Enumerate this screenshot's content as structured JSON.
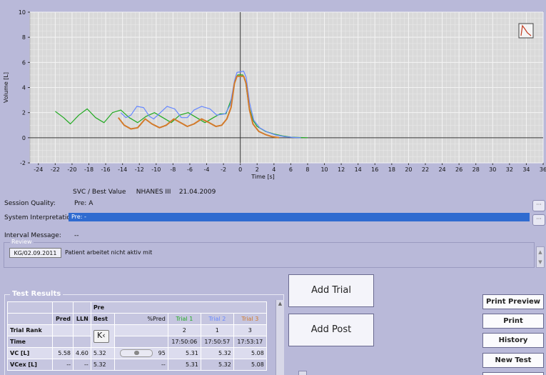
{
  "chart_data": {
    "type": "line",
    "xlabel": "Time [s]",
    "ylabel": "Volume [L]",
    "xlim": [
      -25,
      36
    ],
    "ylim": [
      -2,
      10
    ],
    "xticks": [
      -24,
      -22,
      -20,
      -18,
      -16,
      -14,
      -12,
      -10,
      -8,
      -6,
      -4,
      -2,
      0,
      2,
      4,
      6,
      8,
      10,
      12,
      14,
      16,
      18,
      20,
      22,
      24,
      26,
      28,
      30,
      32,
      34,
      36
    ],
    "yticks": [
      -2,
      0,
      2,
      4,
      6,
      8,
      10
    ],
    "grid": true,
    "series": [
      {
        "name": "Trial 1",
        "color": "#22aa22",
        "points": [
          [
            -22,
            2.1
          ],
          [
            -21,
            1.6
          ],
          [
            -20.2,
            1.1
          ],
          [
            -19.2,
            1.8
          ],
          [
            -18.2,
            2.3
          ],
          [
            -17.2,
            1.6
          ],
          [
            -16.2,
            1.2
          ],
          [
            -15.2,
            2.0
          ],
          [
            -14.2,
            2.2
          ],
          [
            -13.2,
            1.6
          ],
          [
            -12.2,
            1.2
          ],
          [
            -11.2,
            1.7
          ],
          [
            -10.2,
            2.0
          ],
          [
            -9.2,
            1.6
          ],
          [
            -8.2,
            1.2
          ],
          [
            -7.2,
            1.8
          ],
          [
            -6.2,
            2.0
          ],
          [
            -5.2,
            1.6
          ],
          [
            -4.2,
            1.2
          ],
          [
            -3.2,
            1.6
          ],
          [
            -2.4,
            1.9
          ],
          [
            -1.7,
            1.9
          ],
          [
            -1.0,
            3.2
          ],
          [
            -0.6,
            4.6
          ],
          [
            -0.3,
            5.0
          ],
          [
            0.3,
            5.0
          ],
          [
            0.6,
            4.6
          ],
          [
            1.0,
            2.6
          ],
          [
            1.5,
            1.4
          ],
          [
            2.0,
            0.9
          ],
          [
            3,
            0.5
          ],
          [
            4,
            0.3
          ],
          [
            5,
            0.15
          ],
          [
            6,
            0.05
          ],
          [
            7,
            0.02
          ],
          [
            8,
            0
          ]
        ]
      },
      {
        "name": "Trial 2",
        "color": "#6688ff",
        "points": [
          [
            -14.2,
            2.0
          ],
          [
            -13.6,
            1.6
          ],
          [
            -13,
            1.8
          ],
          [
            -12.3,
            2.5
          ],
          [
            -11.5,
            2.4
          ],
          [
            -10.8,
            1.7
          ],
          [
            -10.3,
            1.5
          ],
          [
            -9.5,
            2.0
          ],
          [
            -8.7,
            2.5
          ],
          [
            -7.8,
            2.3
          ],
          [
            -7.0,
            1.6
          ],
          [
            -6.3,
            1.6
          ],
          [
            -5.5,
            2.2
          ],
          [
            -4.6,
            2.5
          ],
          [
            -3.6,
            2.3
          ],
          [
            -2.8,
            1.8
          ],
          [
            -1.8,
            1.9
          ],
          [
            -1.2,
            2.6
          ],
          [
            -0.7,
            4.5
          ],
          [
            -0.4,
            5.2
          ],
          [
            0.4,
            5.3
          ],
          [
            0.7,
            4.8
          ],
          [
            1.1,
            2.8
          ],
          [
            1.6,
            1.4
          ],
          [
            2.3,
            0.8
          ],
          [
            3.2,
            0.45
          ],
          [
            4.2,
            0.22
          ],
          [
            5.3,
            0.08
          ],
          [
            6.4,
            0.02
          ],
          [
            7.2,
            0
          ]
        ]
      },
      {
        "name": "Trial 3",
        "color": "#d27a2a",
        "points": [
          [
            -14.5,
            1.6
          ],
          [
            -13.8,
            1.0
          ],
          [
            -13,
            0.7
          ],
          [
            -12.2,
            0.8
          ],
          [
            -11.3,
            1.5
          ],
          [
            -10.5,
            1.1
          ],
          [
            -9.6,
            0.8
          ],
          [
            -8.8,
            1.0
          ],
          [
            -7.9,
            1.5
          ],
          [
            -7.1,
            1.2
          ],
          [
            -6.3,
            0.9
          ],
          [
            -5.5,
            1.1
          ],
          [
            -4.6,
            1.5
          ],
          [
            -3.7,
            1.2
          ],
          [
            -2.9,
            0.9
          ],
          [
            -2.2,
            1.0
          ],
          [
            -1.6,
            1.5
          ],
          [
            -1.1,
            2.4
          ],
          [
            -0.7,
            4.3
          ],
          [
            -0.4,
            4.9
          ],
          [
            0.4,
            4.9
          ],
          [
            0.7,
            4.3
          ],
          [
            1.1,
            2.2
          ],
          [
            1.5,
            1.1
          ],
          [
            2.2,
            0.5
          ],
          [
            3.0,
            0.25
          ],
          [
            3.8,
            0.08
          ],
          [
            4.6,
            0
          ]
        ]
      }
    ]
  },
  "chart_icon": "lung-curve-icon",
  "meta": {
    "header": "SVC / Best Value",
    "reference": "NHANES III",
    "date": "21.04.2009",
    "session_quality_label": "Session Quality:",
    "session_quality_value": "Pre: A",
    "system_interpretation_label": "System Interpretation:",
    "system_interpretation_value": "Pre: -",
    "interval_message_label": "Interval Message:",
    "interval_message_value": "--",
    "more_label": "···"
  },
  "review": {
    "legend": "Review",
    "tag": "KG/02.09.2011",
    "text": "Patient arbeitet nicht aktiv mit"
  },
  "results": {
    "title": "Test Results",
    "group_label": "Pre",
    "headers": {
      "pred": "Pred",
      "lln": "LLN",
      "best": "Best",
      "pct": "%Pred",
      "trial1": "Trial 1",
      "trial2": "Trial 2",
      "trial3": "Trial 3"
    },
    "kk_label": "K",
    "rows": [
      {
        "label": "Trial Rank",
        "pred": "",
        "lln": "",
        "best": "",
        "pct": "",
        "t1": "2",
        "t2": "1",
        "t3": "3"
      },
      {
        "label": "Time",
        "pred": "",
        "lln": "",
        "best": "",
        "pct": "",
        "t1": "17:50:06",
        "t2": "17:50:57",
        "t3": "17:53:17"
      },
      {
        "label": "VC [L]",
        "pred": "5.58",
        "lln": "4.60",
        "best": "5.32",
        "pct": "95",
        "t1": "5.31",
        "t2": "5.32",
        "t3": "5.08",
        "slider_fraction": 0.5
      },
      {
        "label": "VCex [L]",
        "pred": "--",
        "lln": "--",
        "best": "5.32",
        "pct": "--",
        "t1": "5.31",
        "t2": "5.32",
        "t3": "5.08"
      }
    ]
  },
  "buttons": {
    "add_trial": "Add Trial",
    "add_post": "Add Post",
    "print_preview": "Print Preview",
    "print": "Print",
    "history": "History",
    "new_test": "New Test"
  }
}
